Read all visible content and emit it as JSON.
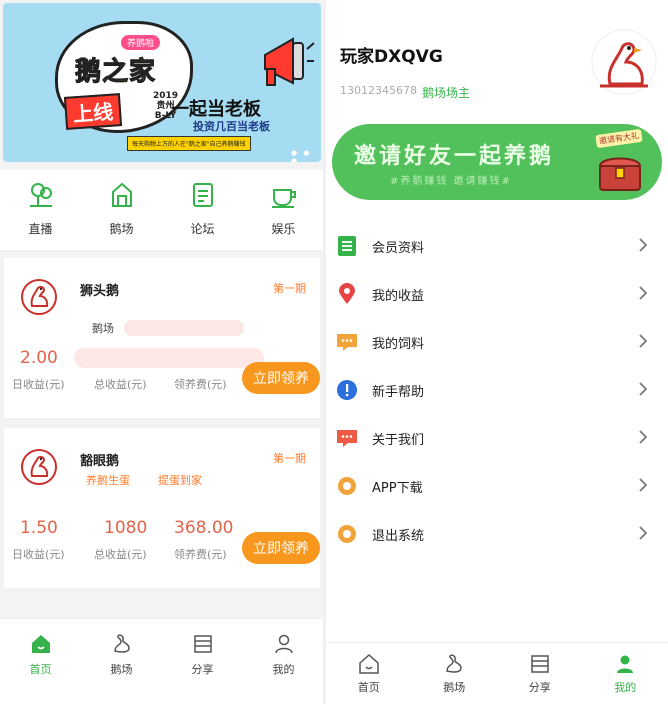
{
  "left": {
    "banner": {
      "tag": "养鹅啦",
      "title": "鹅之家",
      "up_text": "上线",
      "year": "2019",
      "region": "贵州",
      "region2": "B-LY",
      "slogan": "一起当老板",
      "sub": "投资几百当老板",
      "strip": "每天购物上万的人在\"鹅之家\"自己养鹅赚钱"
    },
    "quicknav": [
      {
        "label": "直播",
        "icon": "tree-icon"
      },
      {
        "label": "鹅场",
        "icon": "house-icon"
      },
      {
        "label": "论坛",
        "icon": "document-icon"
      },
      {
        "label": "娱乐",
        "icon": "cup-icon"
      }
    ],
    "cards": [
      {
        "name": "狮头鹅",
        "period": "第一期",
        "sublabel": "鹅场",
        "daily": "2.00",
        "daily_label": "日收益(元)",
        "total": "",
        "total_label": "总收益(元)",
        "fee": "",
        "fee_label": "领养费(元)",
        "button": "立即领养"
      },
      {
        "name": "豁眼鹅",
        "period": "第一期",
        "tag1": "养鹅生蛋",
        "tag2": "提蛋到家",
        "daily": "1.50",
        "daily_label": "日收益(元)",
        "total": "1080",
        "total_label": "总收益(元)",
        "fee": "368.00",
        "fee_label": "领养费(元)",
        "button": "立即领养"
      }
    ],
    "tabbar": [
      {
        "label": "首页",
        "icon": "home-icon",
        "active": true
      },
      {
        "label": "鹅场",
        "icon": "goose-icon",
        "active": false
      },
      {
        "label": "分享",
        "icon": "share-list-icon",
        "active": false
      },
      {
        "label": "我的",
        "icon": "user-icon",
        "active": false
      }
    ]
  },
  "right": {
    "username": "玩家DXQVG",
    "phone": "13012345678",
    "role": "鹅场场主",
    "invite": {
      "title": "邀请好友一起养鹅",
      "subtitle": "#养鹅赚钱 邀请赚钱#",
      "stamp": "邀请有大礼"
    },
    "menu": [
      {
        "label": "会员资料",
        "icon": "list-icon",
        "color": "#35b34a"
      },
      {
        "label": "我的收益",
        "icon": "location-pin-icon",
        "color": "#e64545"
      },
      {
        "label": "我的饲料",
        "icon": "chat-bubble-icon",
        "color": "#f2a43a"
      },
      {
        "label": "新手帮助",
        "icon": "info-icon",
        "color": "#2a6fdb"
      },
      {
        "label": "关于我们",
        "icon": "message-icon",
        "color": "#ee5a44"
      },
      {
        "label": "APP下载",
        "icon": "flower-icon",
        "color": "#f2a43a"
      },
      {
        "label": "退出系统",
        "icon": "flower-icon",
        "color": "#f2a43a"
      }
    ],
    "tabbar": [
      {
        "label": "首页",
        "icon": "home-icon",
        "active": false
      },
      {
        "label": "鹅场",
        "icon": "goose-icon",
        "active": false
      },
      {
        "label": "分享",
        "icon": "share-list-icon",
        "active": false
      },
      {
        "label": "我的",
        "icon": "user-icon",
        "active": true
      }
    ]
  },
  "colors": {
    "brand_green": "#35b34a",
    "accent_orange": "#f7971e",
    "value_red": "#e3634a"
  }
}
